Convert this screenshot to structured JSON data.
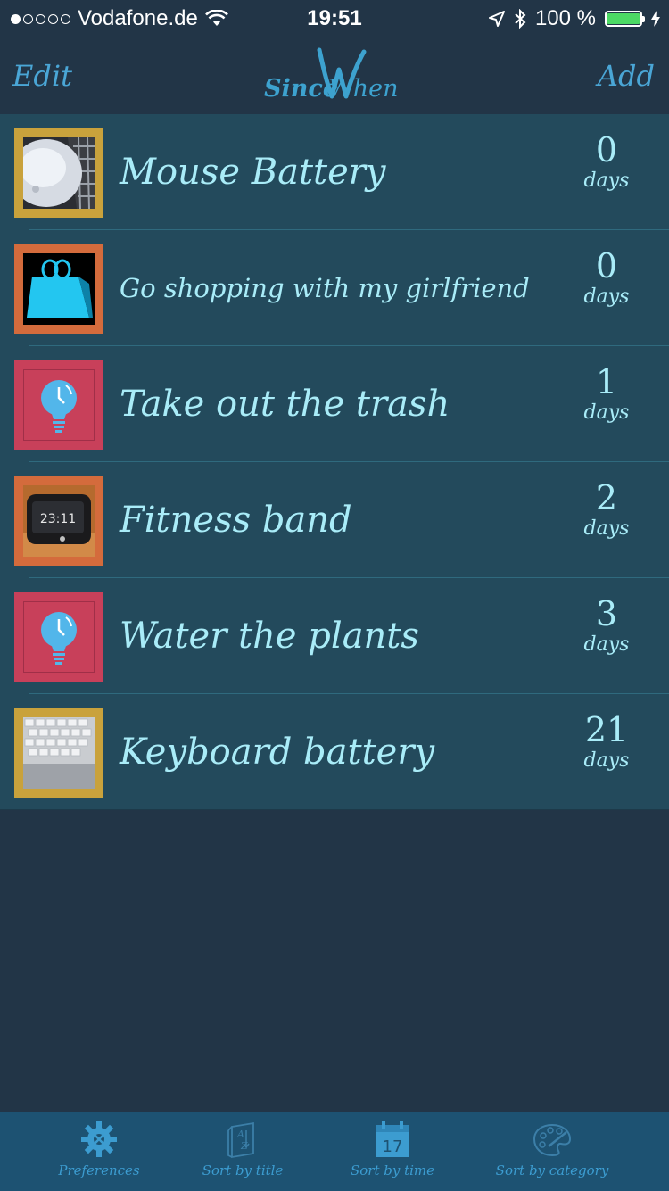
{
  "status_bar": {
    "carrier": "Vodafone.de",
    "time": "19:51",
    "battery": "100 %",
    "icons": [
      "signal-dots-icon",
      "wifi-icon",
      "location-icon",
      "bluetooth-icon",
      "battery-icon",
      "charging-icon"
    ]
  },
  "nav": {
    "edit_label": "Edit",
    "add_label": "Add",
    "logo_text_since": "Since",
    "logo_text_when": "When"
  },
  "items": [
    {
      "title": "Mouse  Battery",
      "count": "0",
      "unit": "days",
      "frame_color": "#c9a23c",
      "thumb": "mouse-photo"
    },
    {
      "title": "Go shopping with my girlfriend",
      "count": "0",
      "unit": "days",
      "frame_color": "#d46b3c",
      "thumb": "shopping-bag-icon"
    },
    {
      "title": "Take out the trash",
      "count": "1",
      "unit": "days",
      "frame_color": "#c8405a",
      "thumb": "lightbulb-clock-icon"
    },
    {
      "title": "Fitness band",
      "count": "2",
      "unit": "days",
      "frame_color": "#d46b3c",
      "thumb": "fitness-band-photo",
      "band_time": "23:11"
    },
    {
      "title": "Water the plants",
      "count": "3",
      "unit": "days",
      "frame_color": "#c8405a",
      "thumb": "lightbulb-clock-icon"
    },
    {
      "title": "Keyboard battery",
      "count": "21",
      "unit": "days",
      "frame_color": "#c9a23c",
      "thumb": "keyboard-photo"
    }
  ],
  "tabs": [
    {
      "label": "Preferences",
      "icon": "gear-icon"
    },
    {
      "label": "Sort by title",
      "icon": "sort-az-icon"
    },
    {
      "label": "Sort by time",
      "icon": "calendar-icon",
      "icon_text": "17"
    },
    {
      "label": "Sort by category",
      "icon": "palette-icon"
    }
  ],
  "colors": {
    "background": "#223547",
    "row": "#234a5c",
    "text": "#a9ecf8",
    "accent": "#4aa6d6",
    "tabbar": "#1d5272"
  }
}
